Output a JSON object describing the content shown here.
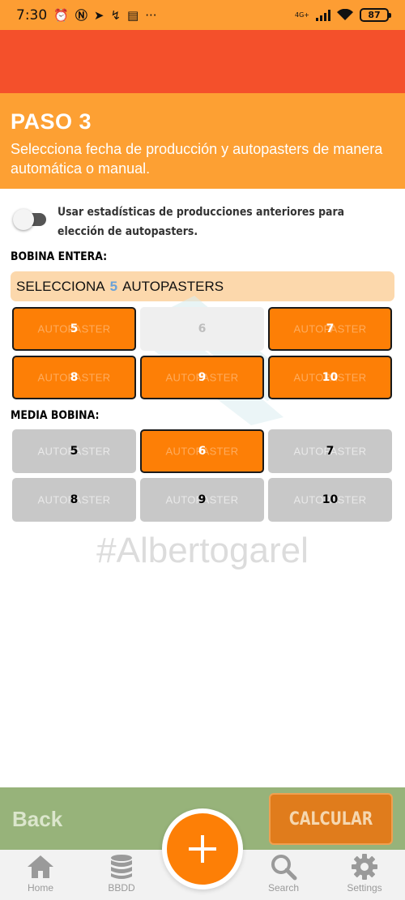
{
  "status_bar": {
    "time": "7:30",
    "network": "4G+",
    "battery": "87"
  },
  "step": {
    "title": "PASO 3",
    "description": "Selecciona fecha de producción y autopasters de manera automática o manual."
  },
  "toggle": {
    "label": "Usar estadísticas de producciones anteriores para elección de autopasters.",
    "state": "off"
  },
  "bobina_entera": {
    "label": "BOBINA ENTERA:",
    "select_prefix": "SELECCIONA",
    "select_count": "5",
    "select_suffix": "AUTOPASTERS",
    "tiles": [
      {
        "number": "5",
        "caption": "AUTOPASTER",
        "state": "selected"
      },
      {
        "number": "6",
        "caption": "",
        "state": "unavailable"
      },
      {
        "number": "7",
        "caption": "AUTOPASTER",
        "state": "selected"
      },
      {
        "number": "8",
        "caption": "AUTOPASTER",
        "state": "selected"
      },
      {
        "number": "9",
        "caption": "AUTOPASTER",
        "state": "selected"
      },
      {
        "number": "10",
        "caption": "AUTOPASTER",
        "state": "selected"
      }
    ]
  },
  "media_bobina": {
    "label": "MEDIA BOBINA:",
    "tiles": [
      {
        "number": "5",
        "caption": "AUTOPASTER",
        "state": "unselected"
      },
      {
        "number": "6",
        "caption": "AUTOPASTER",
        "state": "selected"
      },
      {
        "number": "7",
        "caption": "AUTOPASTER",
        "state": "unselected"
      },
      {
        "number": "8",
        "caption": "AUTOPASTER",
        "state": "unselected"
      },
      {
        "number": "9",
        "caption": "AUTOPASTER",
        "state": "unselected"
      },
      {
        "number": "10",
        "caption": "AUTOPASTER",
        "state": "unselected"
      }
    ]
  },
  "watermark": "#Albertogarel",
  "actions": {
    "back": "Back",
    "calculate": "CALCULAR"
  },
  "nav": [
    {
      "label": "Home",
      "icon": "home-icon"
    },
    {
      "label": "BBDD",
      "icon": "database-icon"
    },
    {
      "label": "Search",
      "icon": "search-icon"
    },
    {
      "label": "Settings",
      "icon": "gear-icon"
    }
  ],
  "colors": {
    "header_orange": "#fda033",
    "top_red": "#f4502b",
    "selected_tile": "#fd7f06",
    "unselected_tile": "#c8c8c8",
    "action_bar": "#97b37a",
    "calculate_button": "#e07c1c"
  }
}
